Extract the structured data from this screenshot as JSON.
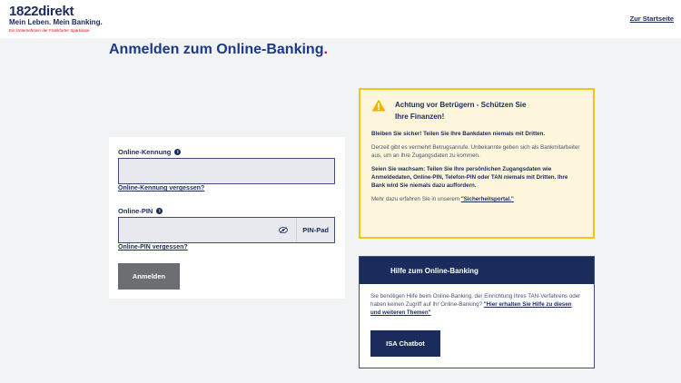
{
  "header": {
    "logo_main": "1822direkt",
    "logo_slogan": "Mein Leben. Mein Banking.",
    "logo_tagline": "Ein Unternehmen der Frankfurter Sparkasse",
    "startseite_link": "Zur Startseite"
  },
  "page": {
    "title": "Anmelden zum Online-Banking",
    "title_dot": "."
  },
  "login": {
    "kennung_label": "Online-Kennung",
    "kennung_value": "",
    "kennung_forgot": "Online-Kennung vergessen?",
    "pin_label": "Online-PIN",
    "pin_value": "",
    "pinpad_label": "PIN-Pad",
    "pin_forgot": "Online-PIN vergessen?",
    "submit_label": "Anmelden"
  },
  "warning": {
    "title_line1": "Achtung vor Betrügern - Schützen Sie",
    "title_line2": "Ihre Finanzen!",
    "p1": "Bleiben Sie sicher! Teilen Sie Ihre Bankdaten niemals mit Dritten.",
    "p2": "Derzeit gibt es vermehrt Betrugsanrufe. Unbekannte geben sich als Bankmitarbeiter aus, um an Ihre Zugangsdaten zu kommen.",
    "p3": "Seien Sie wachsam: Teilen Sie Ihre persönlichen Zugangsdaten wie Anmeldedaten, Online-PIN, Telefon-PIN oder TAN niemals mit Dritten. Ihre Bank wird Sie niemals dazu auffordern.",
    "p4_text": "Mehr dazu erfahren Sie in unserem ",
    "p4_link": "\"Sicherheitsportal.\""
  },
  "help": {
    "title": "Hilfe zum Online-Banking",
    "text": "Sie benötigen Hilfe beim Online-Banking, der Einrichtung Ihres TAN-Verfahrens oder haben keinen Zugriff auf Ihr Online-Banking? ",
    "link": "\"Hier erhalten Sie Hilfe zu diesen und weiteren Themen\"",
    "chatbot_label": "ISA Chatbot"
  },
  "colors": {
    "brand_navy": "#1a2b5c",
    "brand_red": "#e2001a",
    "warning_border": "#f0c419",
    "warning_bg": "#fdf6dc",
    "button_grey": "#6d6e71"
  },
  "icons": [
    "info-icon",
    "eye-icon",
    "warning-icon"
  ]
}
